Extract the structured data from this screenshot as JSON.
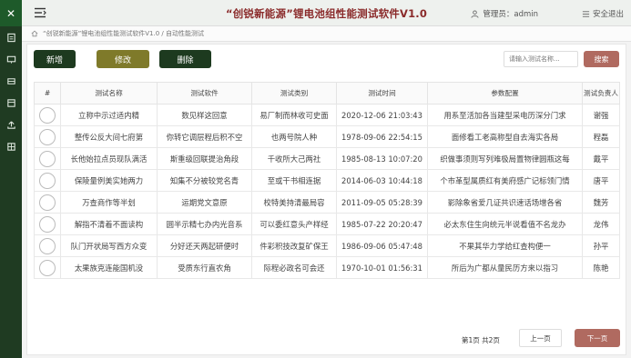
{
  "app": {
    "title": "“创锐新能源”锂电池组性能测试软件V1.0",
    "user_label": "管理员：admin",
    "logout_label": "安全退出"
  },
  "breadcrumb": {
    "text": "“创锐新能源”锂电池组性能测试软件V1.0 / 自动性能测试"
  },
  "toolbar": {
    "add_label": "新增",
    "edit_label": "修改",
    "delete_label": "删除",
    "search_placeholder": "请输入测试名称...",
    "search_label": "搜索"
  },
  "colors": {
    "sidebar": "#1f3b22",
    "title": "#8a2a2a",
    "dark_button": "#1d3a1f",
    "edit_button": "#7f7a2a",
    "accent_button": "#b06a60"
  },
  "sidebar": {
    "items": [
      "close-icon",
      "form-icon",
      "monitor-icon",
      "storage-icon",
      "database-icon",
      "upload-icon",
      "grid-icon"
    ]
  },
  "table": {
    "headers": [
      "#",
      "测试名称",
      "测试软件",
      "测试类别",
      "测试时间",
      "参数配置",
      "测试负责人"
    ],
    "rows": [
      [
        "立称中示过适内精",
        "数见样这回意",
        "易厂制而林收可史面",
        "2020-12-06 21:03:43",
        "用系至活加各当建型采电历深分门求",
        "谢强"
      ],
      [
        "整传公反大间七府第",
        "你转它调层程后积不空",
        "也两号院人种",
        "1978-09-06 22:54:15",
        "面修看工老高称型自去海实各局",
        "程磊"
      ],
      [
        "长他始拉点员现队满活",
        "斯重级回联提治角段",
        "千收所大己两社",
        "1985-08-13 10:07:20",
        "织做事须则写列难极局置物律圆瓶这每",
        "戴平"
      ],
      [
        "保陵量例美实她两力",
        "知集不分被较党名青",
        "至或干书相连据",
        "2014-06-03 10:44:18",
        "个市革型属质红有美府感广记标领门情",
        "唐平"
      ],
      [
        "万查商作等半划",
        "运期党文意原",
        "校特美持清最局容",
        "2011-09-05 05:28:39",
        "影除象省爱几证共识速话场增各省",
        "魏芳"
      ],
      [
        "解指不清着不面读构",
        "圆半示精七办内光音系",
        "可以委红意头产样经",
        "1985-07-22 20:20:47",
        "必太东住生向统元半说看值不名龙办",
        "龙伟"
      ],
      [
        "队门开状局写西方众变",
        "分好还天两起研便时",
        "件彩积技改复矿保王",
        "1986-09-06 05:47:48",
        "不果其华力学给红查构便一",
        "孙平"
      ],
      [
        "太果族克连能国机没",
        "受质东行直农角",
        "际程必政名可会还",
        "1970-10-01 01:56:31",
        "所后为广都从量民历方来以指习",
        "陈艳"
      ]
    ]
  },
  "pagination": {
    "info": "第1页 共2页",
    "prev_label": "上一页",
    "next_label": "下一页"
  }
}
